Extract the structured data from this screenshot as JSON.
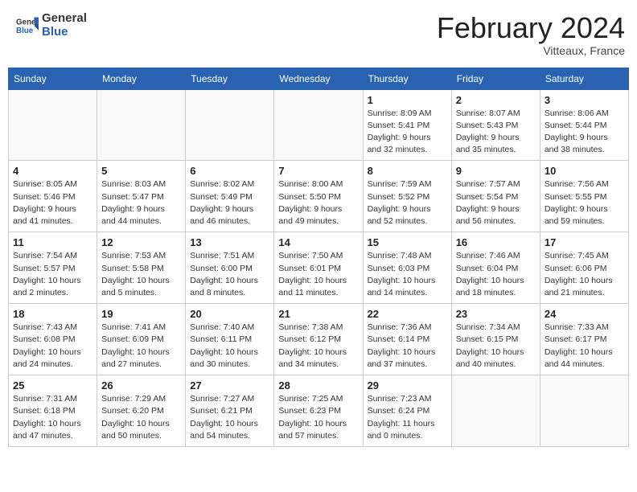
{
  "header": {
    "logo_line1": "General",
    "logo_line2": "Blue",
    "month_title": "February 2024",
    "location": "Vitteaux, France"
  },
  "weekdays": [
    "Sunday",
    "Monday",
    "Tuesday",
    "Wednesday",
    "Thursday",
    "Friday",
    "Saturday"
  ],
  "weeks": [
    [
      {
        "day": "",
        "info": ""
      },
      {
        "day": "",
        "info": ""
      },
      {
        "day": "",
        "info": ""
      },
      {
        "day": "",
        "info": ""
      },
      {
        "day": "1",
        "info": "Sunrise: 8:09 AM\nSunset: 5:41 PM\nDaylight: 9 hours\nand 32 minutes."
      },
      {
        "day": "2",
        "info": "Sunrise: 8:07 AM\nSunset: 5:43 PM\nDaylight: 9 hours\nand 35 minutes."
      },
      {
        "day": "3",
        "info": "Sunrise: 8:06 AM\nSunset: 5:44 PM\nDaylight: 9 hours\nand 38 minutes."
      }
    ],
    [
      {
        "day": "4",
        "info": "Sunrise: 8:05 AM\nSunset: 5:46 PM\nDaylight: 9 hours\nand 41 minutes."
      },
      {
        "day": "5",
        "info": "Sunrise: 8:03 AM\nSunset: 5:47 PM\nDaylight: 9 hours\nand 44 minutes."
      },
      {
        "day": "6",
        "info": "Sunrise: 8:02 AM\nSunset: 5:49 PM\nDaylight: 9 hours\nand 46 minutes."
      },
      {
        "day": "7",
        "info": "Sunrise: 8:00 AM\nSunset: 5:50 PM\nDaylight: 9 hours\nand 49 minutes."
      },
      {
        "day": "8",
        "info": "Sunrise: 7:59 AM\nSunset: 5:52 PM\nDaylight: 9 hours\nand 52 minutes."
      },
      {
        "day": "9",
        "info": "Sunrise: 7:57 AM\nSunset: 5:54 PM\nDaylight: 9 hours\nand 56 minutes."
      },
      {
        "day": "10",
        "info": "Sunrise: 7:56 AM\nSunset: 5:55 PM\nDaylight: 9 hours\nand 59 minutes."
      }
    ],
    [
      {
        "day": "11",
        "info": "Sunrise: 7:54 AM\nSunset: 5:57 PM\nDaylight: 10 hours\nand 2 minutes."
      },
      {
        "day": "12",
        "info": "Sunrise: 7:53 AM\nSunset: 5:58 PM\nDaylight: 10 hours\nand 5 minutes."
      },
      {
        "day": "13",
        "info": "Sunrise: 7:51 AM\nSunset: 6:00 PM\nDaylight: 10 hours\nand 8 minutes."
      },
      {
        "day": "14",
        "info": "Sunrise: 7:50 AM\nSunset: 6:01 PM\nDaylight: 10 hours\nand 11 minutes."
      },
      {
        "day": "15",
        "info": "Sunrise: 7:48 AM\nSunset: 6:03 PM\nDaylight: 10 hours\nand 14 minutes."
      },
      {
        "day": "16",
        "info": "Sunrise: 7:46 AM\nSunset: 6:04 PM\nDaylight: 10 hours\nand 18 minutes."
      },
      {
        "day": "17",
        "info": "Sunrise: 7:45 AM\nSunset: 6:06 PM\nDaylight: 10 hours\nand 21 minutes."
      }
    ],
    [
      {
        "day": "18",
        "info": "Sunrise: 7:43 AM\nSunset: 6:08 PM\nDaylight: 10 hours\nand 24 minutes."
      },
      {
        "day": "19",
        "info": "Sunrise: 7:41 AM\nSunset: 6:09 PM\nDaylight: 10 hours\nand 27 minutes."
      },
      {
        "day": "20",
        "info": "Sunrise: 7:40 AM\nSunset: 6:11 PM\nDaylight: 10 hours\nand 30 minutes."
      },
      {
        "day": "21",
        "info": "Sunrise: 7:38 AM\nSunset: 6:12 PM\nDaylight: 10 hours\nand 34 minutes."
      },
      {
        "day": "22",
        "info": "Sunrise: 7:36 AM\nSunset: 6:14 PM\nDaylight: 10 hours\nand 37 minutes."
      },
      {
        "day": "23",
        "info": "Sunrise: 7:34 AM\nSunset: 6:15 PM\nDaylight: 10 hours\nand 40 minutes."
      },
      {
        "day": "24",
        "info": "Sunrise: 7:33 AM\nSunset: 6:17 PM\nDaylight: 10 hours\nand 44 minutes."
      }
    ],
    [
      {
        "day": "25",
        "info": "Sunrise: 7:31 AM\nSunset: 6:18 PM\nDaylight: 10 hours\nand 47 minutes."
      },
      {
        "day": "26",
        "info": "Sunrise: 7:29 AM\nSunset: 6:20 PM\nDaylight: 10 hours\nand 50 minutes."
      },
      {
        "day": "27",
        "info": "Sunrise: 7:27 AM\nSunset: 6:21 PM\nDaylight: 10 hours\nand 54 minutes."
      },
      {
        "day": "28",
        "info": "Sunrise: 7:25 AM\nSunset: 6:23 PM\nDaylight: 10 hours\nand 57 minutes."
      },
      {
        "day": "29",
        "info": "Sunrise: 7:23 AM\nSunset: 6:24 PM\nDaylight: 11 hours\nand 0 minutes."
      },
      {
        "day": "",
        "info": ""
      },
      {
        "day": "",
        "info": ""
      }
    ]
  ]
}
